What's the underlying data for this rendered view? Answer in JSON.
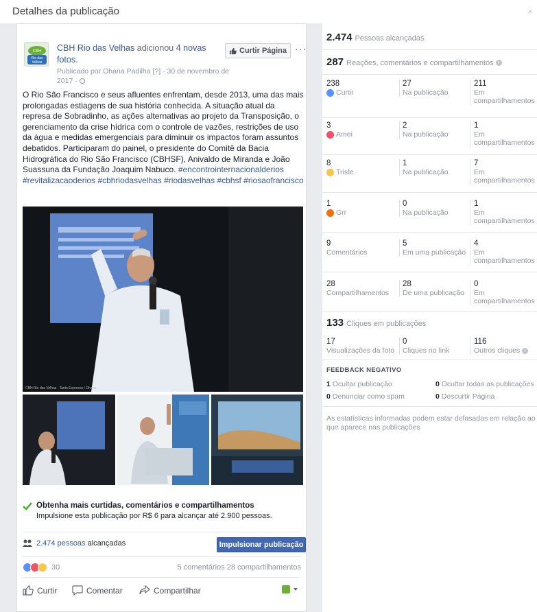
{
  "window": {
    "title": "Detalhes da publicação",
    "close_glyph": "×"
  },
  "post": {
    "page_name": "CBH Rio das Velhas",
    "added_text": " adicionou ",
    "photos_count_text": "4 novas",
    "photos_text_2": "fotos.",
    "published_by": "Publicado por Ohana Padilha [?] · 30 de novembro de",
    "published_by_2": "2017 · ",
    "avatar_label_lines": [
      "CBH",
      "Rio das",
      "Velhas"
    ],
    "like_page_label": "Curtir Página",
    "more_label": "···",
    "body": "O Rio São Francisco e seus afluentes enfrentam, desde 2013, uma das mais prolongadas estiagens de sua história conhecida. A situação atual da represa de Sobradinho, as ações alternativas ao projeto da Transposição, o gerenciamento da crise hídrica com o controle de vazões, restrições de uso da água e medidas emergenciais para diminuir os impactos foram assuntos debatidos. Participaram do painel, o presidente do Comitê da Bacia Hidrográfica do Rio São Francisco (CBHSF), Anivaldo de Miranda e João Suassuna da Fundação Joaquim Nabuco.",
    "hashtags": "#encontrointernacionalderios #revitalizacaoderios #cbhriodasvelhas #riodasvelhas #cbhsf #riosaofrancisco",
    "photo_credit": "CBH Rio das Velhas · Tanto Expresso / Ohana",
    "boost_title": "Obtenha mais curtidas, comentários e compartilhamentos",
    "boost_sub": "Impulsione esta publicação por R$ 6 para alcançar até 2.900 pessoas.",
    "reach_count": "2.474 pessoas",
    "reach_suffix": " alcançadas",
    "boost_button": "Impulsionar publicação",
    "reactions_count": "30",
    "comments_shares": "5 comentários  28 compartilhamentos",
    "actions": {
      "like": "Curtir",
      "comment": "Comentar",
      "share": "Compartilhar"
    }
  },
  "insights": {
    "people_reached": {
      "value": "2.474",
      "label": "Pessoas alcançadas"
    },
    "engagement": {
      "value": "287",
      "label": "Reações, comentários e compartilhamentos"
    },
    "rows": [
      {
        "total": "238",
        "label": "Curtir",
        "icon": "like-icon",
        "on_post": "27",
        "on_post_label": "Na publicação",
        "on_shares": "211",
        "on_shares_label_1": "Em",
        "on_shares_label_2": "compartilhamentos"
      },
      {
        "total": "3",
        "label": "Amei",
        "icon": "love-icon",
        "on_post": "2",
        "on_post_label": "Na publicação",
        "on_shares": "1",
        "on_shares_label_1": "Em",
        "on_shares_label_2": "compartilhamentos"
      },
      {
        "total": "8",
        "label": "Triste",
        "icon": "sad-icon",
        "on_post": "1",
        "on_post_label": "Na publicação",
        "on_shares": "7",
        "on_shares_label_1": "Em",
        "on_shares_label_2": "compartilhamentos"
      },
      {
        "total": "1",
        "label": "Grr",
        "icon": "angry-icon",
        "on_post": "0",
        "on_post_label": "Na publicação",
        "on_shares": "1",
        "on_shares_label_1": "Em",
        "on_shares_label_2": "compartilhamentos"
      },
      {
        "total": "9",
        "label": "Comentários",
        "icon": "",
        "on_post": "5",
        "on_post_label": "Em uma publicação",
        "on_shares": "4",
        "on_shares_label_1": "Em",
        "on_shares_label_2": "compartilhamentos"
      },
      {
        "total": "28",
        "label": "Compartilhamentos",
        "icon": "",
        "on_post": "28",
        "on_post_label": "De uma publicação",
        "on_shares": "0",
        "on_shares_label_1": "Em",
        "on_shares_label_2": "compartilhamentos"
      }
    ],
    "clicks": {
      "value": "133",
      "label": "Cliques em publicações"
    },
    "click_breakdown": [
      {
        "value": "17",
        "label": "Visualizações da foto"
      },
      {
        "value": "0",
        "label": "Cliques no link"
      },
      {
        "value": "116",
        "label": "Outros cliques"
      }
    ],
    "negative": {
      "heading": "FEEDBACK NEGATIVO",
      "items": [
        {
          "value": "1",
          "label": "Ocultar publicação"
        },
        {
          "value": "0",
          "label": "Ocultar todas as publicações"
        },
        {
          "value": "0",
          "label": "Denunciar como spam"
        },
        {
          "value": "0",
          "label": "Descurtir Página"
        }
      ]
    },
    "note": "As estatísticas informadas podem estar defasadas em relação ao que aparece nas publicações"
  },
  "colors": {
    "link": "#365899",
    "boost_button": "#4267b2",
    "muted": "#90949c",
    "like_blue": "#5890ff",
    "love_red": "#f25268",
    "sad_yellow": "#f7c74a",
    "angry_orange": "#e9710f",
    "check_green": "#42b72a"
  }
}
